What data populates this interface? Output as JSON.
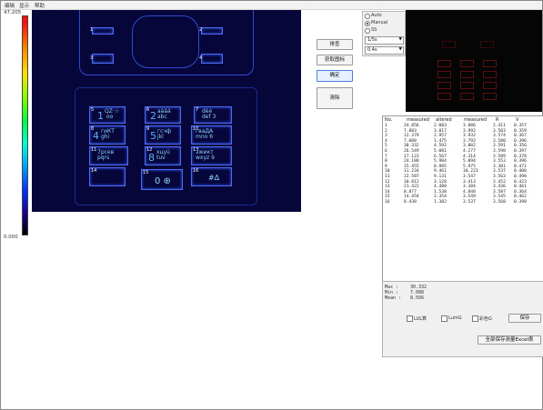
{
  "menu": [
    "编辑",
    "显示",
    "帮助"
  ],
  "scale": {
    "max_label": "47.205",
    "min_label": "0.000"
  },
  "keys": [
    {
      "num": "5",
      "digit": "1",
      "text": "QZ·☆\n oo"
    },
    {
      "num": "6",
      "digit": "2",
      "text": "aàäá\nabc"
    },
    {
      "num": "7",
      "digit": "",
      "text": "dèé\ndef 3"
    },
    {
      "num": "8",
      "digit": "4",
      "text": "гиКТ\nghi"
    },
    {
      "num": "9",
      "digit": "5",
      "text": "гсчф\njkl"
    },
    {
      "num": "10",
      "digit": "",
      "text": "гваДА\nmno 6"
    },
    {
      "num": "11",
      "digit": "",
      "text": "7рсев\npqrs"
    },
    {
      "num": "12",
      "digit": "8",
      "text": "хцуü\ntuv"
    },
    {
      "num": "13",
      "digit": "",
      "text": "зжикт\nwxyz 9"
    },
    {
      "num": "14",
      "digit": "",
      "text": ""
    },
    {
      "num": "15",
      "digit": "",
      "text": "0 ⊕"
    },
    {
      "num": "16",
      "digit": "",
      "text": "#∆"
    }
  ],
  "top_keys": [
    "1",
    "2",
    "3",
    "4"
  ],
  "buttons": {
    "b1": "排查",
    "b2": "获取图标",
    "b3": "确定",
    "b4": "清除"
  },
  "options": {
    "radios": [
      "Auto",
      "Manual",
      "SS"
    ],
    "selected": 1,
    "select1": "1/5s",
    "select2": "0.4s"
  },
  "table": {
    "headers": [
      "No.",
      "measured",
      "altered",
      "measured",
      "R",
      "V"
    ],
    "rows": [
      [
        "1",
        "24.856",
        "2.083",
        "3.886",
        "2.411",
        "0.357"
      ],
      [
        "2",
        "7.883",
        "3.017",
        "3.992",
        "3.503",
        "0.359"
      ],
      [
        "3",
        "12.379",
        "2.957",
        "3.932",
        "3.574",
        "0.367"
      ],
      [
        "4",
        "7.088",
        "1.475",
        "3.792",
        "3.580",
        "0.396"
      ],
      [
        "5",
        "30.332",
        "4.592",
        "3.082",
        "3.591",
        "0.356"
      ],
      [
        "6",
        "26.549",
        "5.081",
        "4.277",
        "3.598",
        "0.397"
      ],
      [
        "7",
        "17.123",
        "6.567",
        "4.314",
        "3.589",
        "0.378"
      ],
      [
        "8",
        "24.180",
        "5.984",
        "5.894",
        "3.553",
        "0.396"
      ],
      [
        "9",
        "15.455",
        "8.985",
        "5.975",
        "3.301",
        "0.471"
      ],
      [
        "10",
        "11.234",
        "9.461",
        "10.223",
        "3.537",
        "0.408"
      ],
      [
        "11",
        "22.587",
        "9.131",
        "3.547",
        "3.563",
        "0.498"
      ],
      [
        "12",
        "10.812",
        "3.128",
        "3.413",
        "3.452",
        "0.423"
      ],
      [
        "13",
        "21.422",
        "4.488",
        "3.384",
        "3.436",
        "0.461"
      ],
      [
        "14",
        "8.877",
        "1.538",
        "4.848",
        "3.587",
        "0.364"
      ],
      [
        "15",
        "14.454",
        "3.354",
        "3.549",
        "3.545",
        "0.462"
      ],
      [
        "16",
        "8.438",
        "1.382",
        "3.537",
        "3.568",
        "0.398"
      ]
    ]
  },
  "summary": {
    "rows": [
      {
        "label": "Max :",
        "value": "30.332"
      },
      {
        "label": "Min :",
        "value": "7.088"
      },
      {
        "label": "Mean :",
        "value": "8.566"
      }
    ]
  },
  "checkboxes": [
    "LUL算",
    "LumG",
    "彩色G"
  ],
  "save_button": "保存",
  "export_button": "全部保存测量Excel表",
  "colors": {
    "image_bg": "#06063a",
    "key_border": "#4b6cf0"
  }
}
